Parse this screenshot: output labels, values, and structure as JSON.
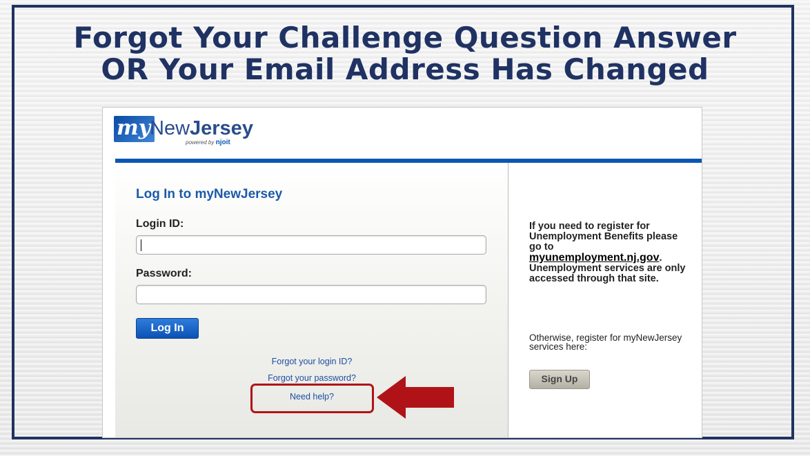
{
  "slide": {
    "title_line1": "Forgot Your Challenge Question Answer",
    "title_line2": "OR Your Email Address Has Changed"
  },
  "logo": {
    "my": "my",
    "new": "New",
    "jersey": "Jersey",
    "powered_by": "powered by",
    "powered_brand": "njoit"
  },
  "login": {
    "title": "Log In to myNewJersey",
    "login_id_label": "Login ID:",
    "password_label": "Password:",
    "login_id_value": "",
    "password_value": "",
    "login_button": "Log In",
    "forgot_login": "Forgot your login ID?",
    "forgot_password": "Forgot your password?",
    "need_help": "Need help?"
  },
  "info": {
    "line1": "If you need to register for Unemployment Benefits please go to",
    "site": "myunemployment.nj.gov",
    "site_suffix": ".",
    "line2": "Unemployment services are only accessed through that site.",
    "other": "Otherwise, register for myNewJersey services here:",
    "signup_button": "Sign Up"
  },
  "colors": {
    "title_navy": "#1f3263",
    "accent_blue": "#0a57b2",
    "highlight_red": "#b01317"
  },
  "icons": {
    "arrow": "left-arrow-icon"
  }
}
